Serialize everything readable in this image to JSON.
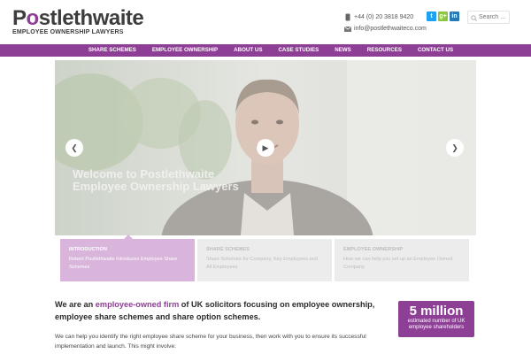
{
  "brand": {
    "name_p": "P",
    "name_o": "o",
    "name_rest": "stlethwaite",
    "tagline": "EMPLOYEE OWNERSHIP LAWYERS",
    "accent_color": "#8d3f95"
  },
  "contact": {
    "phone": "+44 (0) 20 3818 9420",
    "email": "info@postlethwaiteco.com",
    "phone_icon": "phone-icon",
    "email_icon": "envelope-icon"
  },
  "social": [
    {
      "name": "twitter",
      "glyph": "t"
    },
    {
      "name": "google-plus",
      "glyph": "g+"
    },
    {
      "name": "linkedin",
      "glyph": "in"
    }
  ],
  "search": {
    "placeholder": "Search ..."
  },
  "nav": {
    "items": [
      "SHARE SCHEMES",
      "EMPLOYEE OWNERSHIP",
      "ABOUT US",
      "CASE STUDIES",
      "NEWS",
      "RESOURCES",
      "CONTACT US"
    ]
  },
  "hero": {
    "title_line1": "Welcome to Postlethwaite",
    "title_line2": "Employee Ownership Lawyers"
  },
  "tabs": [
    {
      "title": "INTRODUCTION",
      "text": "Robert Postlethwaite Introduces Employee Share Schemes",
      "active": true
    },
    {
      "title": "SHARE SCHEMES",
      "text": "Share Schemes for Company, Key Employees and All Employees",
      "active": false
    },
    {
      "title": "EMPLOYEE OWNERSHIP",
      "text": "How we can help you set up an Employee Owned Company",
      "active": false
    }
  ],
  "intro": {
    "part1": "We are an ",
    "highlight": "employee-owned firm",
    "part2": " of UK solicitors focusing on employee ownership, employee share schemes and share option schemes."
  },
  "body": {
    "text": "We can help you identify the right employee share scheme for your business, then work with you to ensure its successful implementation and launch. This might involve:"
  },
  "stat": {
    "value": "5 million",
    "caption_line1": "estimated number of UK",
    "caption_line2": "employee shareholders"
  }
}
